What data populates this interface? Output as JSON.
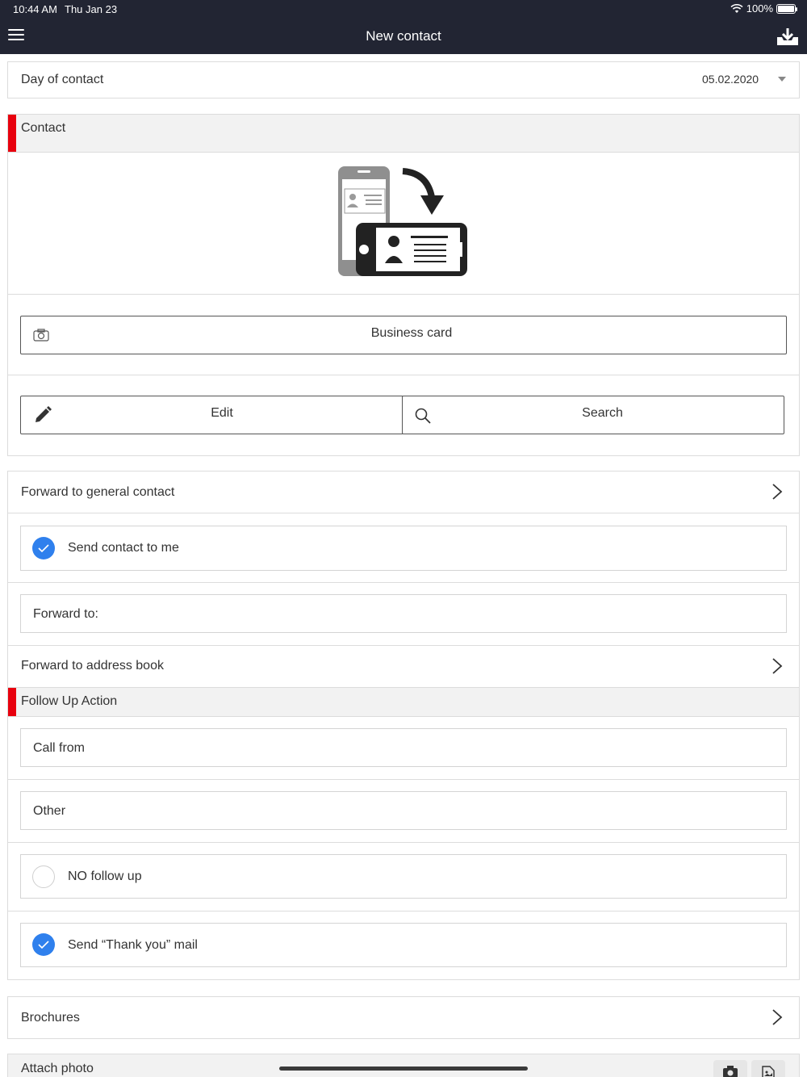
{
  "status_bar": {
    "time": "10:44 AM",
    "date": "Thu Jan 23",
    "battery": "100%"
  },
  "header": {
    "title": "New contact"
  },
  "day_of_contact": {
    "label": "Day of contact",
    "value": "05.02.2020"
  },
  "contact_section": {
    "title": "Contact",
    "business_card_label": "Business card",
    "edit_label": "Edit",
    "search_label": "Search"
  },
  "forward_general": {
    "label": "Forward to general contact"
  },
  "send_to_me": {
    "label": "Send contact to me",
    "checked": true
  },
  "forward_to": {
    "label": "Forward to:"
  },
  "forward_address_book": {
    "label": "Forward to address book"
  },
  "follow_up_section": {
    "title": "Follow Up Action",
    "call_from_label": "Call from",
    "other_label": "Other",
    "no_follow_up_label": "NO follow up",
    "no_follow_up_checked": false,
    "thank_you_label": "Send “Thank you” mail",
    "thank_you_checked": true
  },
  "brochures": {
    "label": "Brochures"
  },
  "attach_photo": {
    "label": "Attach photo"
  },
  "colors": {
    "header_bg": "#222533",
    "accent_red": "#e8000e",
    "check_blue": "#2f80ed"
  }
}
